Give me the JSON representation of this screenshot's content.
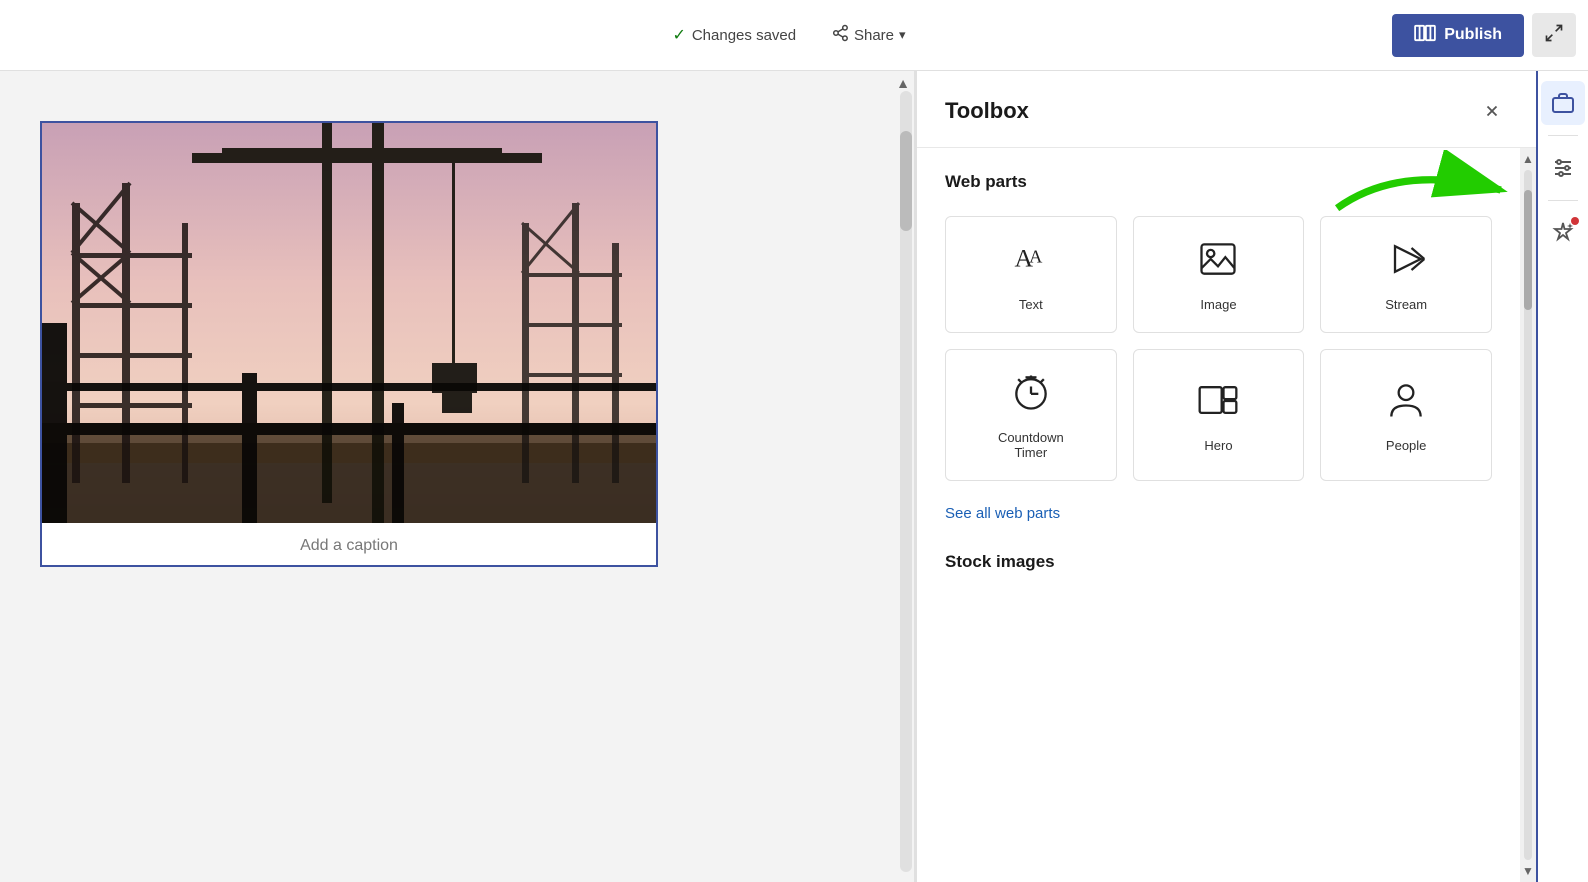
{
  "topbar": {
    "changes_saved": "Changes saved",
    "share_label": "Share",
    "publish_label": "Publish",
    "collapse_icon": "collapse-icon"
  },
  "toolbox": {
    "title": "Toolbox",
    "close_icon": "close-icon",
    "webparts_section": "Web parts",
    "see_all_label": "See all web parts",
    "stock_images_section": "Stock images",
    "items": [
      {
        "id": "text",
        "label": "Text"
      },
      {
        "id": "image",
        "label": "Image"
      },
      {
        "id": "stream",
        "label": "Stream"
      },
      {
        "id": "countdown",
        "label": "Countdown Timer"
      },
      {
        "id": "hero",
        "label": "Hero"
      },
      {
        "id": "people",
        "label": "People"
      }
    ]
  },
  "canvas": {
    "caption_placeholder": "Add a caption"
  },
  "sidebar": {
    "icons": [
      {
        "id": "toolbox",
        "label": "Toolbox",
        "active": true
      },
      {
        "id": "settings",
        "label": "Settings",
        "active": false
      },
      {
        "id": "ai",
        "label": "AI Assistant",
        "active": false,
        "has_dot": true
      }
    ]
  }
}
